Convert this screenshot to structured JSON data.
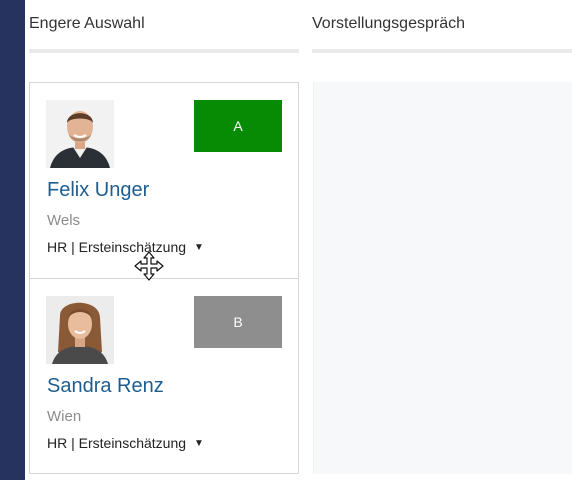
{
  "columns": [
    {
      "title": "Engere Auswahl"
    },
    {
      "title": "Vorstellungsgespräch"
    }
  ],
  "candidates": [
    {
      "name": "Felix Unger",
      "city": "Wels",
      "stage": "HR | Ersteinschätzung",
      "badge": "A",
      "badge_color": "#078a04"
    },
    {
      "name": "Sandra Renz",
      "city": "Wien",
      "stage": "HR | Ersteinschätzung",
      "badge": "B",
      "badge_color": "#8e8e8e"
    }
  ],
  "icons": {
    "stage_dropdown": "caret-down-icon",
    "cursor": "move-cursor-icon"
  },
  "colors": {
    "page_bg": "#26335f",
    "link": "#1f5d8f"
  }
}
